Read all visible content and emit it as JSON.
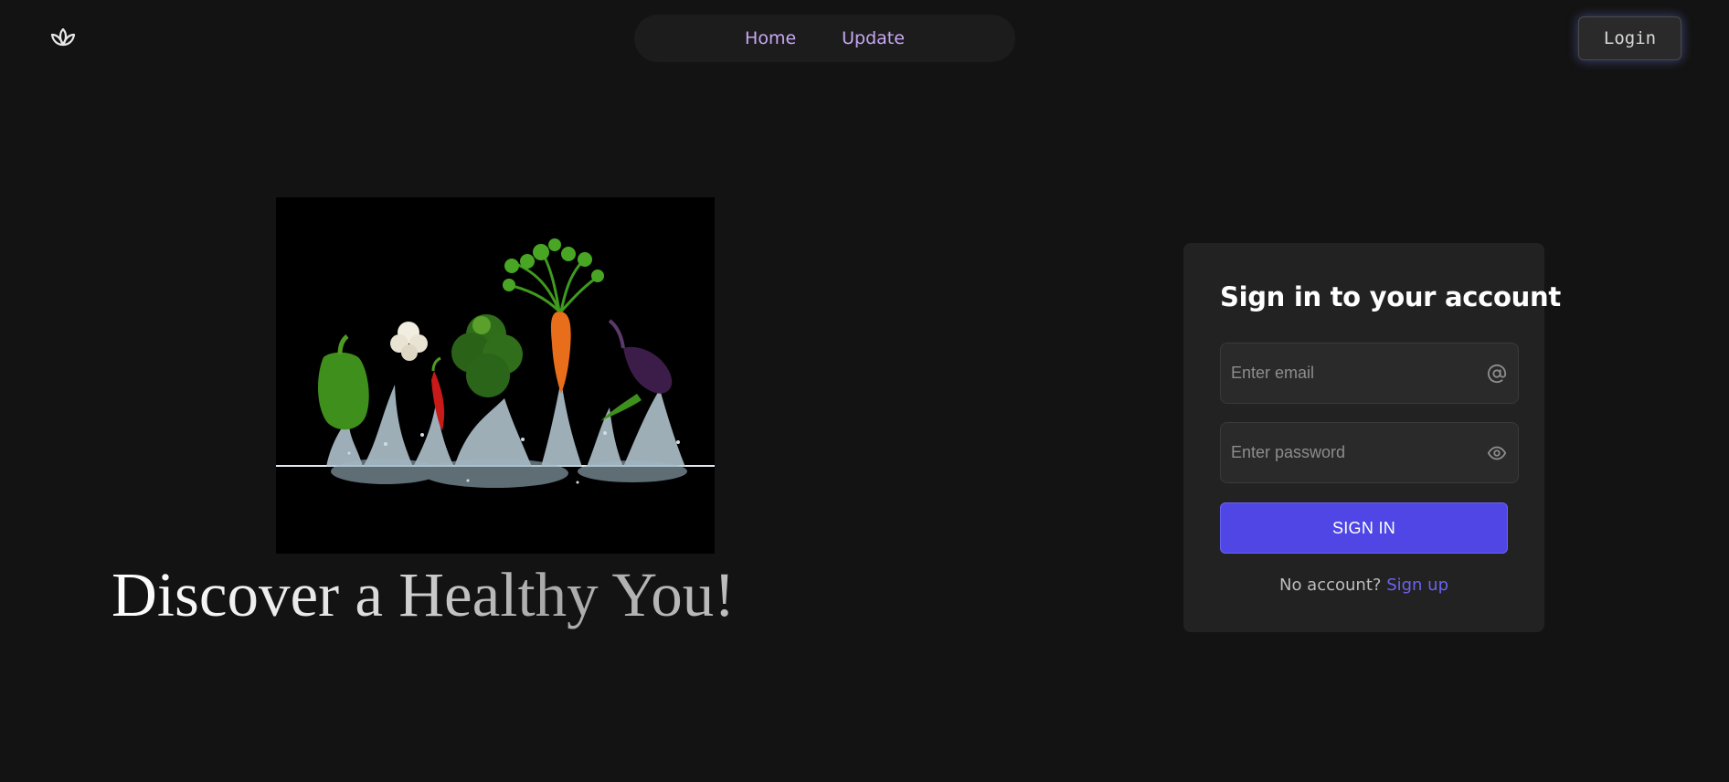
{
  "header": {
    "logo_icon": "lotus-icon",
    "nav": [
      {
        "label": "Home"
      },
      {
        "label": "Update"
      }
    ],
    "login_label": "Login"
  },
  "hero": {
    "image": "vegetables-splash-image",
    "title": "Discover a Healthy You!"
  },
  "signin": {
    "title": "Sign in to your account",
    "email_placeholder": "Enter email",
    "email_icon": "at-sign-icon",
    "password_placeholder": "Enter password",
    "password_icon": "eye-icon",
    "button_label": "SIGN IN",
    "no_account_text": "No account?",
    "signup_label": "Sign up"
  },
  "colors": {
    "background": "#131313",
    "accent": "#4f46e5",
    "nav_link": "#c9a8f5",
    "card": "#222222"
  }
}
